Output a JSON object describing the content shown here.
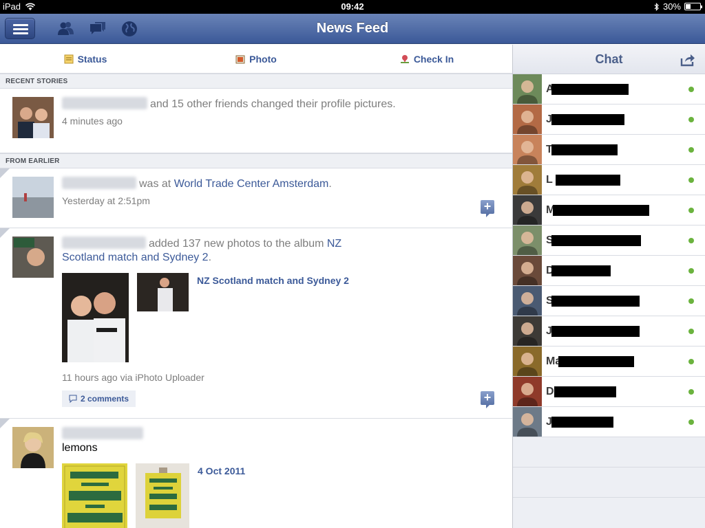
{
  "status_bar": {
    "device": "iPad",
    "time": "09:42",
    "battery": "30%",
    "battery_level": 0.3
  },
  "nav": {
    "title": "News Feed",
    "icons": [
      "menu-icon",
      "friends-icon",
      "messages-icon",
      "notifications-globe-icon"
    ]
  },
  "publisher": [
    {
      "label": "Status",
      "icon": "status-icon"
    },
    {
      "label": "Photo",
      "icon": "photo-icon"
    },
    {
      "label": "Check In",
      "icon": "check-in-icon"
    }
  ],
  "feed": {
    "recent_header": "RECENT STORIES",
    "earlier_header": "FROM EARLIER",
    "stories": [
      {
        "text": "and 15 other friends changed their profile pictures.",
        "meta": "4 minutes ago"
      },
      {
        "text": "was at",
        "place": "World Trade Center Amsterdam",
        "end": ".",
        "meta": "Yesterday at 2:51pm"
      },
      {
        "text": "added 137 new photos to the album",
        "album": "NZ Scotland match and Sydney 2",
        "end": ".",
        "album_label": "NZ Scotland match and Sydney 2",
        "meta": "11 hours ago via iPhoto Uploader",
        "comments": "2 comments"
      },
      {
        "text": "lemons",
        "album_label": "4 Oct 2011"
      }
    ]
  },
  "chat": {
    "title": "Chat",
    "friends": [
      {
        "initial": "A"
      },
      {
        "initial": "J"
      },
      {
        "initial": "T"
      },
      {
        "initial": "L"
      },
      {
        "initial": "M"
      },
      {
        "initial": "S"
      },
      {
        "initial": "D"
      },
      {
        "initial": "S"
      },
      {
        "initial": "J"
      },
      {
        "initial": "Ma"
      },
      {
        "initial": "D"
      },
      {
        "initial": "J"
      }
    ]
  }
}
